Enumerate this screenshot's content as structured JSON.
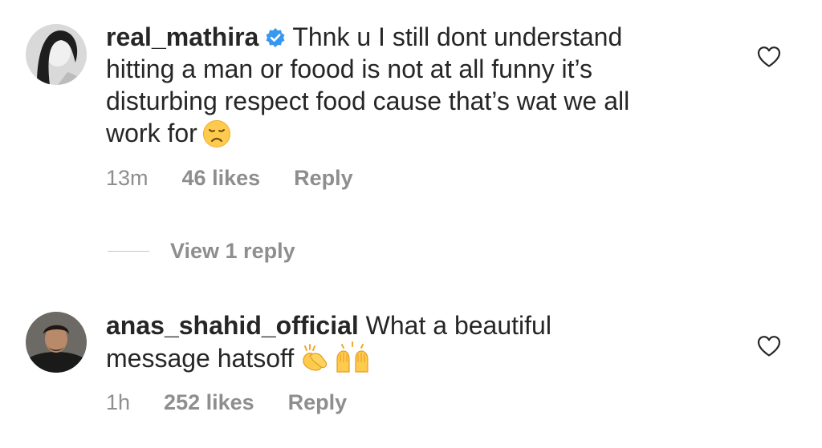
{
  "comments": [
    {
      "username": "real_mathira",
      "verified": true,
      "text_lines": [
        "Thnk u I still dont understand",
        "hitting a man or foood is not at all funny it’s",
        "disturbing respect food cause that’s wat we all",
        "work for"
      ],
      "emoji": "disappointed-face",
      "time": "13m",
      "likes": "46 likes",
      "reply_label": "Reply",
      "view_replies": "View 1 reply"
    },
    {
      "username": "anas_shahid_official",
      "verified": false,
      "text_lines": [
        "What a beautiful",
        "message hatsoff"
      ],
      "emoji": "clapping-hands, raising-hands",
      "time": "1h",
      "likes": "252 likes",
      "reply_label": "Reply"
    }
  ],
  "colors": {
    "text": "#262626",
    "secondary": "#8e8e8e",
    "verified_blue": "#3897f0",
    "divider": "#c7c7c7"
  }
}
